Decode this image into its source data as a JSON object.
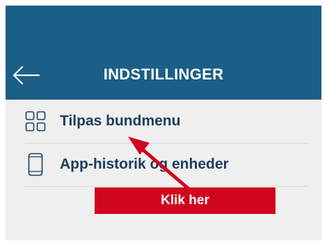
{
  "header": {
    "title": "INDSTILLINGER",
    "back_icon": "arrow-left-icon"
  },
  "settings_list": {
    "items": [
      {
        "label": "Tilpas bundmenu",
        "icon": "grid-icon"
      },
      {
        "label": "App-historik og enheder",
        "icon": "smartphone-icon"
      }
    ]
  },
  "annotation": {
    "callout_text": "Klik her",
    "color": "#d0061e"
  },
  "colors": {
    "header_bg": "#1b5e87",
    "list_bg": "#efefef",
    "label_text": "#1e3c5a"
  }
}
